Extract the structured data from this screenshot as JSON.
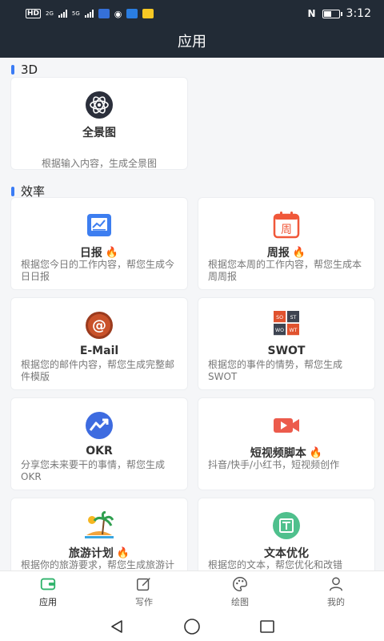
{
  "status": {
    "time": "3:12",
    "hd": "HD",
    "net1": "2G",
    "net2": "5G"
  },
  "header": {
    "title": "应用"
  },
  "sections": [
    {
      "label": "3D"
    },
    {
      "label": "效率"
    }
  ],
  "cards": [
    {
      "name": "全景图",
      "desc": "根据输入内容，生成全景图",
      "icon": "panorama-icon"
    },
    {
      "name": "日报",
      "desc": "根据您今日的工作内容，帮您生成今日日报",
      "icon": "daily-report-icon",
      "hot": "🔥"
    },
    {
      "name": "周报",
      "desc": "根据您本周的工作内容，帮您生成本周周报",
      "icon": "weekly-report-icon",
      "hot": "🔥",
      "icon_text": "周"
    },
    {
      "name": "E-Mail",
      "desc": "根据您的邮件内容，帮您生成完整邮件模版",
      "icon": "email-icon"
    },
    {
      "name": "SWOT",
      "desc": "根据您的事件的情势，帮您生成 SWOT",
      "icon": "swot-icon",
      "icon_cells": [
        "SO",
        "ST",
        "WO",
        "WT"
      ]
    },
    {
      "name": "OKR",
      "desc": "分享您未来要干的事情，帮您生成 OKR",
      "icon": "okr-icon"
    },
    {
      "name": "短视频脚本",
      "desc": "抖音/快手/小红书，短视频创作",
      "icon": "video-script-icon",
      "hot": "🔥"
    },
    {
      "name": "旅游计划",
      "desc": "根据你的旅游要求，帮您生成旅游计划",
      "icon": "travel-plan-icon",
      "hot": "🔥"
    },
    {
      "name": "文本优化",
      "desc": "根据您的文本，帮您优化和改错",
      "icon": "text-optimize-icon"
    }
  ],
  "bottom_nav": [
    {
      "label": "应用",
      "icon": "apps-icon",
      "active": true
    },
    {
      "label": "写作",
      "icon": "write-icon"
    },
    {
      "label": "绘图",
      "icon": "palette-icon"
    },
    {
      "label": "我的",
      "icon": "profile-icon"
    }
  ],
  "colors": {
    "header_bg": "#222b36",
    "accent": "#3b7cf5",
    "nav_active": "#2fb36b",
    "fire": "#f5571d"
  }
}
